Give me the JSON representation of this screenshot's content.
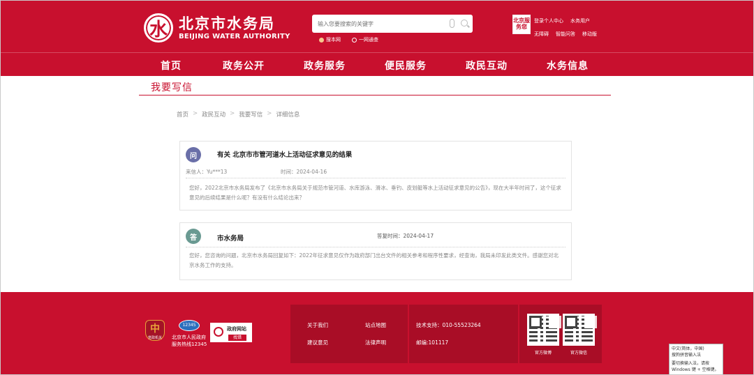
{
  "header": {
    "logo_cn": "北京市水务局",
    "logo_en": "BEIJING WATER AUTHORITY",
    "logo_glyph": "水",
    "search_placeholder": "输入您要搜索的关键字",
    "scope": [
      {
        "label": "搜本网",
        "selected": true
      },
      {
        "label": "一网通查",
        "selected": false
      }
    ],
    "badge_text": "北京服务您",
    "top_links_row1": [
      "登录个人中心",
      "水务用户"
    ],
    "top_links_row2": [
      "无障碍",
      "智能问答",
      "移动版"
    ]
  },
  "nav": {
    "items": [
      "首页",
      "政务公开",
      "政务服务",
      "便民服务",
      "政民互动",
      "水务信息"
    ]
  },
  "section": {
    "title": "我要写信"
  },
  "breadcrumb": [
    "首页",
    "政民互动",
    "我要写信",
    "详细信息"
  ],
  "question": {
    "avatar": "问",
    "title": "有关 北京市市管河道水上活动征求意见的结果",
    "sender_label": "来信人：",
    "sender": "Yu***13",
    "time_label": "时间：",
    "time": "2024-04-16",
    "body": "您好，2022北京市水务局发布了《北京市水务局关于规范市管河道、水库游泳、滑冰、垂钓、皮划艇等水上活动征求意见的公告》，现在大半年时间了，这个征求意见的后续结果是什么呢？有没有什么结论出来？"
  },
  "answer": {
    "avatar": "答",
    "name": "市水务局",
    "time_label": "答复时间：",
    "time": "2024-04-17",
    "body": "您好，您咨询的问题，北京市水务局回复如下：2022年征求意见仅作为政府部门出台文件的相关参考和程序性要求，经查询，我局未印发此类文件。感谢您对北京水务工作的支持。"
  },
  "footer": {
    "emblem_glyph": "中",
    "emblem_label": "党政机关",
    "hotline_icon": "12345",
    "hotline_line1": "北京市人民政府",
    "hotline_line2": "服务热线12345",
    "find_line1": "政府网站",
    "find_line2": "找错",
    "links": [
      "关于我们",
      "站点地图",
      "建议意见",
      "法律声明"
    ],
    "support": "技术支持：010-55523264",
    "zip": "邮编:101117",
    "qr1_label": "官方微博",
    "qr2_label": "官方微信"
  },
  "ime_popup": {
    "line1": "中文(简体，中国)",
    "line2": "搜狗拼音输入法",
    "line3": "要切换输入法，请按",
    "line4": "Windows 键 + 空格键。"
  },
  "colors": {
    "brand_red": "#c8102e",
    "footer_block": "#a90d26",
    "question_avatar": "#6a6fa8",
    "answer_avatar": "#6a9a92"
  }
}
